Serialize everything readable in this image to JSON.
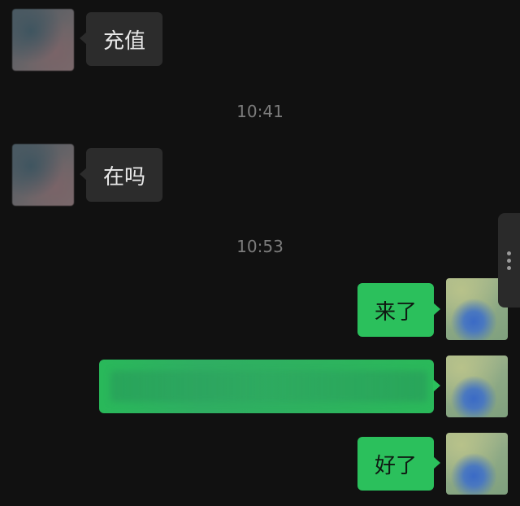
{
  "messages": {
    "m1": {
      "text": "充值",
      "direction": "incoming"
    },
    "t1": "10:41",
    "m2": {
      "text": "在吗",
      "direction": "incoming"
    },
    "t2": "10:53",
    "m3": {
      "text": "来了",
      "direction": "outgoing"
    },
    "m4": {
      "text": "",
      "direction": "outgoing",
      "redacted": true
    },
    "m5": {
      "text": "好了",
      "direction": "outgoing"
    }
  },
  "colors": {
    "background": "#111111",
    "incoming_bubble": "#2c2c2c",
    "outgoing_bubble": "#2bc05c",
    "timestamp": "#7c7c7c"
  },
  "icons": {
    "scroll": "more-vertical-icon"
  }
}
